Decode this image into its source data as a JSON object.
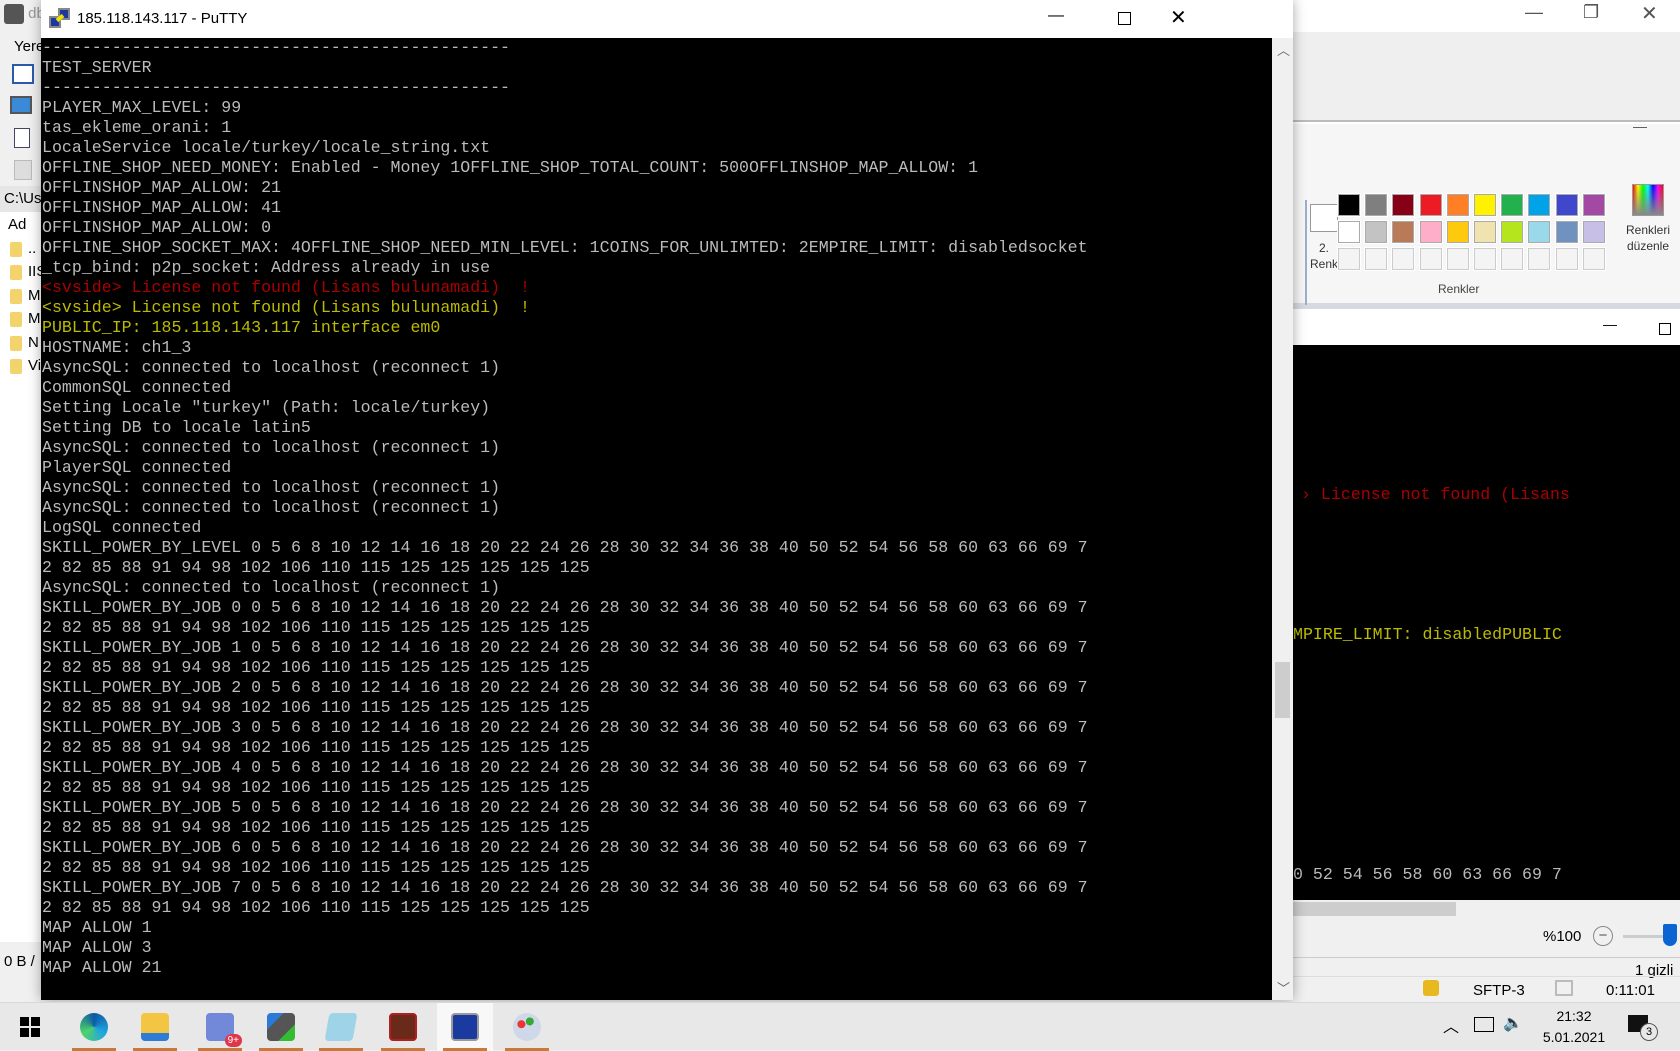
{
  "putty": {
    "title": "185.118.143.117 - PuTTY",
    "lines": [
      {
        "text": "-----------------------------------------------",
        "color": "gray"
      },
      {
        "text": "TEST_SERVER",
        "color": "gray"
      },
      {
        "text": "-----------------------------------------------",
        "color": "gray"
      },
      {
        "text": "PLAYER_MAX_LEVEL: 99",
        "color": "gray"
      },
      {
        "text": "tas_ekleme_orani: 1",
        "color": "gray"
      },
      {
        "text": "LocaleService locale/turkey/locale_string.txt",
        "color": "gray"
      },
      {
        "text": "OFFLINE_SHOP_NEED_MONEY: Enabled - Money 1OFFLINE_SHOP_TOTAL_COUNT: 500OFFLINSHOP_MAP_ALLOW: 1",
        "color": "gray"
      },
      {
        "text": "OFFLINSHOP_MAP_ALLOW: 21",
        "color": "gray"
      },
      {
        "text": "OFFLINSHOP_MAP_ALLOW: 41",
        "color": "gray"
      },
      {
        "text": "OFFLINSHOP_MAP_ALLOW: 0",
        "color": "gray"
      },
      {
        "text": "OFFLINE_SHOP_SOCKET_MAX: 4OFFLINE_SHOP_NEED_MIN_LEVEL: 1COINS_FOR_UNLIMTED: 2EMPIRE_LIMIT: disabledsocket",
        "color": "gray"
      },
      {
        "text": "_tcp_bind: p2p_socket: Address already in use",
        "color": "gray"
      },
      {
        "text": "<svside> License not found (Lisans bulunamadi)  !",
        "color": "red"
      },
      {
        "text": "<svside> License not found (Lisans bulunamadi)  !",
        "color": "yellow"
      },
      {
        "text": "PUBLIC_IP: 185.118.143.117 interface em0",
        "color": "yellow"
      },
      {
        "text": "HOSTNAME: ch1_3",
        "color": "gray"
      },
      {
        "text": "AsyncSQL: connected to localhost (reconnect 1)",
        "color": "gray"
      },
      {
        "text": "CommonSQL connected",
        "color": "gray"
      },
      {
        "text": "Setting Locale \"turkey\" (Path: locale/turkey)",
        "color": "gray"
      },
      {
        "text": "Setting DB to locale latin5",
        "color": "gray"
      },
      {
        "text": "AsyncSQL: connected to localhost (reconnect 1)",
        "color": "gray"
      },
      {
        "text": "PlayerSQL connected",
        "color": "gray"
      },
      {
        "text": "AsyncSQL: connected to localhost (reconnect 1)",
        "color": "gray"
      },
      {
        "text": "AsyncSQL: connected to localhost (reconnect 1)",
        "color": "gray"
      },
      {
        "text": "LogSQL connected",
        "color": "gray"
      },
      {
        "text": "SKILL_POWER_BY_LEVEL 0 5 6 8 10 12 14 16 18 20 22 24 26 28 30 32 34 36 38 40 50 52 54 56 58 60 63 66 69 7",
        "color": "gray"
      },
      {
        "text": "2 82 85 88 91 94 98 102 106 110 115 125 125 125 125 125",
        "color": "gray"
      },
      {
        "text": "AsyncSQL: connected to localhost (reconnect 1)",
        "color": "gray"
      },
      {
        "text": "SKILL_POWER_BY_JOB 0 0 5 6 8 10 12 14 16 18 20 22 24 26 28 30 32 34 36 38 40 50 52 54 56 58 60 63 66 69 7",
        "color": "gray"
      },
      {
        "text": "2 82 85 88 91 94 98 102 106 110 115 125 125 125 125 125",
        "color": "gray"
      },
      {
        "text": "SKILL_POWER_BY_JOB 1 0 5 6 8 10 12 14 16 18 20 22 24 26 28 30 32 34 36 38 40 50 52 54 56 58 60 63 66 69 7",
        "color": "gray"
      },
      {
        "text": "2 82 85 88 91 94 98 102 106 110 115 125 125 125 125 125",
        "color": "gray"
      },
      {
        "text": "SKILL_POWER_BY_JOB 2 0 5 6 8 10 12 14 16 18 20 22 24 26 28 30 32 34 36 38 40 50 52 54 56 58 60 63 66 69 7",
        "color": "gray"
      },
      {
        "text": "2 82 85 88 91 94 98 102 106 110 115 125 125 125 125 125",
        "color": "gray"
      },
      {
        "text": "SKILL_POWER_BY_JOB 3 0 5 6 8 10 12 14 16 18 20 22 24 26 28 30 32 34 36 38 40 50 52 54 56 58 60 63 66 69 7",
        "color": "gray"
      },
      {
        "text": "2 82 85 88 91 94 98 102 106 110 115 125 125 125 125 125",
        "color": "gray"
      },
      {
        "text": "SKILL_POWER_BY_JOB 4 0 5 6 8 10 12 14 16 18 20 22 24 26 28 30 32 34 36 38 40 50 52 54 56 58 60 63 66 69 7",
        "color": "gray"
      },
      {
        "text": "2 82 85 88 91 94 98 102 106 110 115 125 125 125 125 125",
        "color": "gray"
      },
      {
        "text": "SKILL_POWER_BY_JOB 5 0 5 6 8 10 12 14 16 18 20 22 24 26 28 30 32 34 36 38 40 50 52 54 56 58 60 63 66 69 7",
        "color": "gray"
      },
      {
        "text": "2 82 85 88 91 94 98 102 106 110 115 125 125 125 125 125",
        "color": "gray"
      },
      {
        "text": "SKILL_POWER_BY_JOB 6 0 5 6 8 10 12 14 16 18 20 22 24 26 28 30 32 34 36 38 40 50 52 54 56 58 60 63 66 69 7",
        "color": "gray"
      },
      {
        "text": "2 82 85 88 91 94 98 102 106 110 115 125 125 125 125 125",
        "color": "gray"
      },
      {
        "text": "SKILL_POWER_BY_JOB 7 0 5 6 8 10 12 14 16 18 20 22 24 26 28 30 32 34 36 38 40 50 52 54 56 58 60 63 66 69 7",
        "color": "gray"
      },
      {
        "text": "2 82 85 88 91 94 98 102 106 110 115 125 125 125 125 125",
        "color": "gray"
      },
      {
        "text": "MAP ALLOW 1",
        "color": "gray"
      },
      {
        "text": "MAP ALLOW 3",
        "color": "gray"
      },
      {
        "text": "MAP ALLOW 21",
        "color": "gray"
      }
    ]
  },
  "term_colors": {
    "gray": "#bbbbbb",
    "red": "#aa0000",
    "yellow": "#bbbb00"
  },
  "winscp": {
    "title_fragment": "db",
    "location_fragment": "Yere",
    "path_fragment": "C:\\Us",
    "column_name": "Ad",
    "parent_dir": "..",
    "folders": [
      "IIS",
      "M",
      "M",
      "N",
      "Vi"
    ],
    "status_fragment": "0 B /",
    "zoom_level": "%100",
    "hidden_count": "1 gizli",
    "protocol": "SFTP-3",
    "session_time": "0:11:01"
  },
  "paint": {
    "color2_label": "2. Renk",
    "edit_colors_label": "Renkleri düzenle",
    "group_label": "Renkler",
    "colors_row1": [
      "#000000",
      "#7f7f7f",
      "#880015",
      "#ed1c24",
      "#ff7f27",
      "#fff200",
      "#22b14c",
      "#00a2e8",
      "#3f48cc",
      "#a349a4"
    ],
    "colors_row2": [
      "#ffffff",
      "#c3c3c3",
      "#b97a57",
      "#ffaec9",
      "#ffc90e",
      "#efe4b0",
      "#b5e61d",
      "#99d9ea",
      "#7092be",
      "#c8bfe7"
    ]
  },
  "term2": {
    "line_red": "› License not found (Lisans",
    "line_yellow": "MPIRE_LIMIT: disabledPUBLIC",
    "line_gray": "0 52 54 56 58 60 63 66 69 7"
  },
  "taskbar": {
    "apps": [
      "start",
      "edge",
      "file-explorer",
      "discord",
      "winscp",
      "notepad",
      "game",
      "putty",
      "paint"
    ],
    "discord_badge": "9+",
    "time": "21:32",
    "date": "5.01.2021",
    "notification_count": "3"
  }
}
